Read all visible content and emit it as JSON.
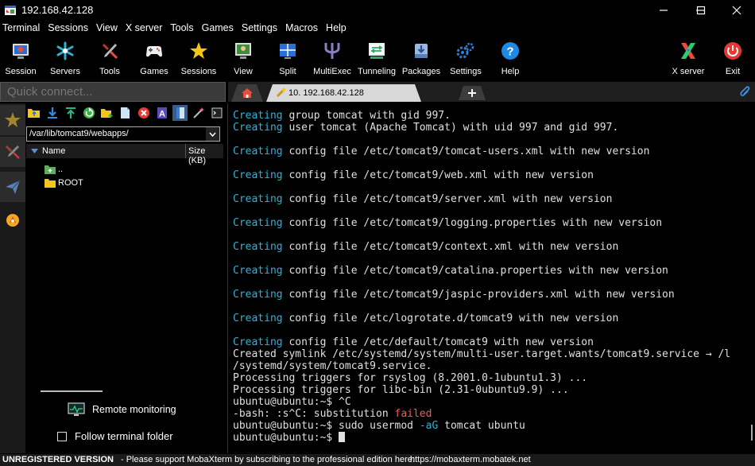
{
  "window": {
    "title": "192.168.42.128"
  },
  "menu": [
    "Terminal",
    "Sessions",
    "View",
    "X server",
    "Tools",
    "Games",
    "Settings",
    "Macros",
    "Help"
  ],
  "toolbar": {
    "session": "Session",
    "servers": "Servers",
    "tools": "Tools",
    "games": "Games",
    "sessions": "Sessions",
    "view": "View",
    "split": "Split",
    "multiexec": "MultiExec",
    "tunneling": "Tunneling",
    "packages": "Packages",
    "settings": "Settings",
    "help": "Help",
    "xserver": "X server",
    "exit": "Exit"
  },
  "quick_connect": {
    "placeholder": "Quick connect..."
  },
  "tabs": {
    "active_label": "10. 192.168.42.128"
  },
  "sftp": {
    "path": "/var/lib/tomcat9/webapps/",
    "columns": {
      "name": "Name",
      "size": "Size (KB)"
    },
    "files": [
      {
        "name": "..",
        "type": "parent"
      },
      {
        "name": "ROOT",
        "type": "folder"
      }
    ],
    "remote_monitoring": "Remote monitoring",
    "follow_folder": "Follow terminal folder"
  },
  "terminal": {
    "lines": [
      [
        {
          "t": "Creating",
          "c": "cy"
        },
        {
          "t": " group tomcat with gid 997."
        }
      ],
      [
        {
          "t": "Creating",
          "c": "cy"
        },
        {
          "t": " user tomcat (Apache Tomcat) with uid 997 and gid 997."
        }
      ],
      [],
      [
        {
          "t": "Creating",
          "c": "cy"
        },
        {
          "t": " config file /etc/tomcat9/tomcat-users.xml with new version"
        }
      ],
      [],
      [
        {
          "t": "Creating",
          "c": "cy"
        },
        {
          "t": " config file /etc/tomcat9/web.xml with new version"
        }
      ],
      [],
      [
        {
          "t": "Creating",
          "c": "cy"
        },
        {
          "t": " config file /etc/tomcat9/server.xml with new version"
        }
      ],
      [],
      [
        {
          "t": "Creating",
          "c": "cy"
        },
        {
          "t": " config file /etc/tomcat9/logging.properties with new version"
        }
      ],
      [],
      [
        {
          "t": "Creating",
          "c": "cy"
        },
        {
          "t": " config file /etc/tomcat9/context.xml with new version"
        }
      ],
      [],
      [
        {
          "t": "Creating",
          "c": "cy"
        },
        {
          "t": " config file /etc/tomcat9/catalina.properties with new version"
        }
      ],
      [],
      [
        {
          "t": "Creating",
          "c": "cy"
        },
        {
          "t": " config file /etc/tomcat9/jaspic-providers.xml with new version"
        }
      ],
      [],
      [
        {
          "t": "Creating",
          "c": "cy"
        },
        {
          "t": " config file /etc/logrotate.d/tomcat9 with new version"
        }
      ],
      [],
      [
        {
          "t": "Creating",
          "c": "cy"
        },
        {
          "t": " config file /etc/default/tomcat9 with new version"
        }
      ],
      [
        {
          "t": "Created symlink /etc/systemd/system/multi-user.target.wants/tomcat9.service → /l"
        }
      ],
      [
        {
          "t": "/systemd/system/tomcat9.service."
        }
      ],
      [
        {
          "t": "Processing triggers for rsyslog (8.2001.0-1ubuntu1.3) ..."
        }
      ],
      [
        {
          "t": "Processing triggers for libc-bin (2.31-0ubuntu9.9) ..."
        }
      ],
      [
        {
          "t": "ubuntu@ubuntu:~$ ^C"
        }
      ],
      [
        {
          "t": "-bash: :s^C: substitution "
        },
        {
          "t": "failed",
          "c": "rd"
        }
      ],
      [
        {
          "t": "ubuntu@ubuntu:~$ sudo usermod "
        },
        {
          "t": "-aG",
          "c": "cy"
        },
        {
          "t": " tomcat ubuntu"
        }
      ],
      [
        {
          "t": "ubuntu@ubuntu:~$ "
        },
        {
          "cursor": true
        }
      ]
    ]
  },
  "status": {
    "unregistered": "UNREGISTERED VERSION",
    "message": " -  Please support MobaXterm by subscribing to the professional edition here:",
    "link": "https://mobaxterm.mobatek.net"
  },
  "colors": {
    "terminal_cyan": "#2ab3d9",
    "terminal_red": "#f05a5a",
    "background": "#000000"
  }
}
